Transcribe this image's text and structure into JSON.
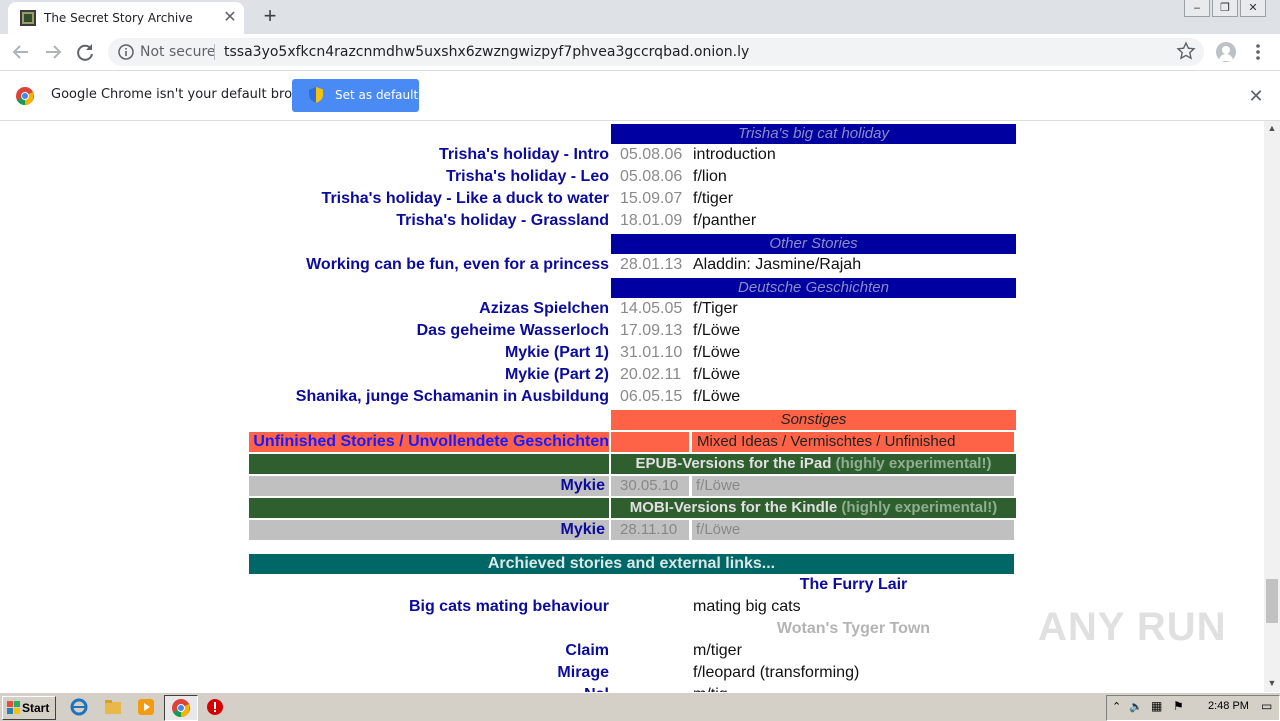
{
  "browser": {
    "tab_title": "The Secret Story Archive",
    "security_label": "Not secure",
    "url": "tssa3yo5xfkcn4razcnmdhw5uxshx6zwzngwizpyf7phvea3gccrqbad.onion.ly",
    "infobar_message": "Google Chrome isn't your default browser",
    "set_default_label": "Set as default",
    "tab_close": "✕",
    "new_tab": "+",
    "infobar_close": "✕"
  },
  "sections": {
    "big_cat": "Trisha's big cat holiday",
    "other": "Other Stories",
    "deutsch": "Deutsche Geschichten",
    "sonstiges": "Sonstiges",
    "unfinished_title": "Unfinished Stories / Unvollendete Geschichten",
    "unfinished_desc": "Mixed Ideas / Vermischtes / Unfinished",
    "epub_title": "EPUB-Versions for the iPad",
    "mobi_title": "MOBI-Versions for the Kindle",
    "experimental": "(highly experimental!)",
    "archived": "Archieved stories and external links..."
  },
  "big_cat_stories": [
    {
      "title": "Trisha's holiday - Intro",
      "date": "05.08.06",
      "category": "introduction"
    },
    {
      "title": "Trisha's holiday - Leo",
      "date": "05.08.06",
      "category": "f/lion"
    },
    {
      "title": "Trisha's holiday - Like a duck to water",
      "date": "15.09.07",
      "category": "f/tiger"
    },
    {
      "title": "Trisha's holiday - Grassland",
      "date": "18.01.09",
      "category": "f/panther"
    }
  ],
  "other_stories": [
    {
      "title": "Working can be fun, even for a princess",
      "date": "28.01.13",
      "category": "Aladdin: Jasmine/Rajah"
    }
  ],
  "german_stories": [
    {
      "title": "Azizas Spielchen",
      "date": "14.05.05",
      "category": "f/Tiger"
    },
    {
      "title": "Das geheime Wasserloch",
      "date": "17.09.13",
      "category": "f/Löwe"
    },
    {
      "title": "Mykie (Part 1)",
      "date": "31.01.10",
      "category": "f/Löwe"
    },
    {
      "title": "Mykie (Part 2)",
      "date": "20.02.11",
      "category": "f/Löwe"
    },
    {
      "title": "Shanika, junge Schamanin in Ausbildung",
      "date": "06.05.15",
      "category": "f/Löwe"
    }
  ],
  "epub": {
    "title": "Mykie",
    "date": "30.05.10",
    "category": "f/Löwe"
  },
  "mobi": {
    "title": "Mykie",
    "date": "28.11.10",
    "category": "f/Löwe"
  },
  "archive": {
    "furry_lair": "The Furry Lair",
    "mating": {
      "title": "Big cats mating behaviour",
      "category": "mating big cats"
    },
    "tyger_town": "Wotan's Tyger Town",
    "claim": {
      "title": "Claim",
      "category": "m/tiger"
    },
    "mirage": {
      "title": "Mirage",
      "category": "f/leopard (transforming)"
    },
    "partial_title": "Nal",
    "partial_category": "m/tig"
  },
  "watermark": "ANY RUN",
  "taskbar": {
    "start_label": "Start",
    "clock": "2:48 PM"
  },
  "colors": {
    "link": "#0b0b9e",
    "section_header": "#0000a0",
    "sonstiges": "#ff6347",
    "epub_band": "#2f5f2f",
    "archive_band": "#006666",
    "gray_row": "#c0c0c0"
  }
}
